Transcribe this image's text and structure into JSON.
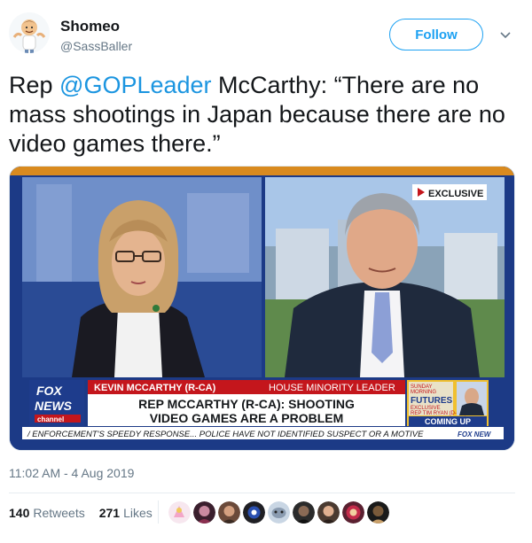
{
  "header": {
    "display_name": "Shomeo",
    "handle": "@SassBaller",
    "follow_label": "Follow"
  },
  "tweet": {
    "prefix": "Rep ",
    "mention": "@GOPLeader",
    "suffix": " McCarthy: “There are no mass shootings in Japan because there are no video games there.”"
  },
  "media": {
    "exclusive_badge": "EXCLUSIVE",
    "network_top": "FOX",
    "network_bottom": "NEWS",
    "network_sub": "channel",
    "name_bar": "KEVIN MCCARTHY (R-CA)",
    "title_bar": "HOUSE MINORITY LEADER",
    "headline_1": "REP MCCARTHY (R-CA): SHOOTING",
    "headline_2": "VIDEO GAMES ARE A PROBLEM",
    "promo_show_top": "SUNDAY",
    "promo_show_mid": "MORNING",
    "promo_title": "FUTURES",
    "promo_exclusive": "EXCLUSIVE",
    "promo_guest": "REP TIM RYAN (D-OH)",
    "promo_coming": "COMING UP",
    "ticker": "/ ENFORCEMENT'S SPEEDY RESPONSE... POLICE HAVE NOT IDENTIFIED SUSPECT OR A MOTIVE",
    "ticker_logo": "FOX NEW"
  },
  "timestamp": "11:02 AM - 4 Aug 2019",
  "stats": {
    "retweets_count": "140",
    "retweets_label": "Retweets",
    "likes_count": "271",
    "likes_label": "Likes"
  },
  "colors": {
    "twitter_blue": "#1da1f2",
    "mention": "#1b95e0",
    "fox_red": "#c4161c",
    "fox_blue": "#1e3c8c"
  }
}
